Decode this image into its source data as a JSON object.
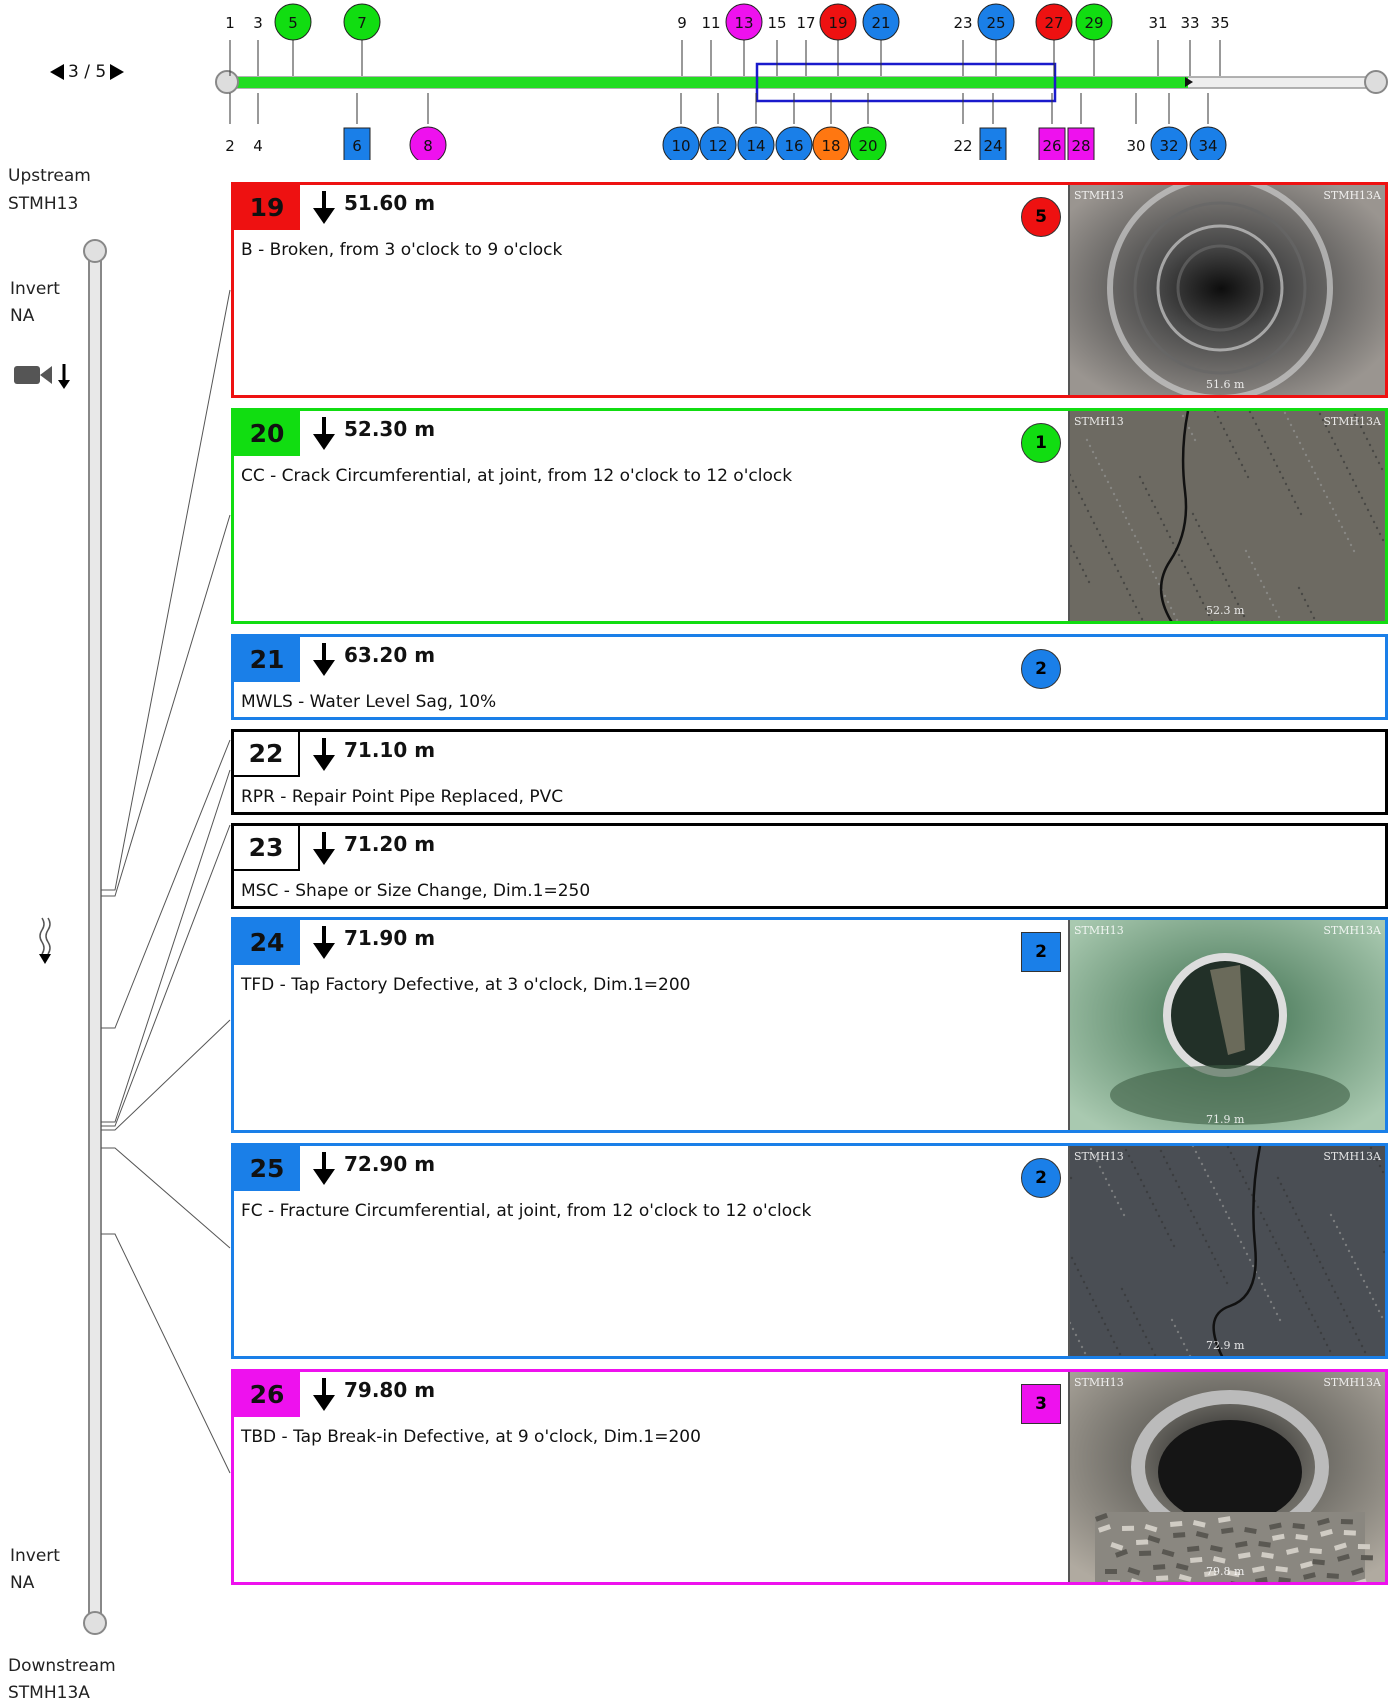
{
  "pager": {
    "text": "3 / 5"
  },
  "pipe": {
    "upstream_label": "Upstream",
    "upstream_id": "STMH13",
    "downstream_label": "Downstream",
    "downstream_id": "STMH13A",
    "invert_top_label": "Invert",
    "invert_top_value": "NA",
    "invert_bottom_label": "Invert",
    "invert_bottom_value": "NA"
  },
  "colors": {
    "red": "#ee1111",
    "green": "#11dd11",
    "blue": "#1a7fe8",
    "magenta": "#ee11ee",
    "orange": "#ff7711",
    "white": "#ffffff",
    "timeline": "#22dd22"
  },
  "timeline": {
    "top_markers": [
      {
        "label": "1",
        "color": "none"
      },
      {
        "label": "3",
        "color": "none"
      },
      {
        "label": "5",
        "color": "green",
        "shape": "circle"
      },
      {
        "label": "7",
        "color": "green",
        "shape": "circle"
      },
      {
        "label": "9",
        "color": "none"
      },
      {
        "label": "11",
        "color": "none"
      },
      {
        "label": "13",
        "color": "magenta",
        "shape": "circle"
      },
      {
        "label": "15",
        "color": "none"
      },
      {
        "label": "17",
        "color": "none"
      },
      {
        "label": "19",
        "color": "red",
        "shape": "circle"
      },
      {
        "label": "21",
        "color": "blue",
        "shape": "circle"
      },
      {
        "label": "23",
        "color": "none"
      },
      {
        "label": "25",
        "color": "blue",
        "shape": "circle"
      },
      {
        "label": "27",
        "color": "red",
        "shape": "circle"
      },
      {
        "label": "29",
        "color": "green",
        "shape": "circle"
      },
      {
        "label": "31",
        "color": "none"
      },
      {
        "label": "33",
        "color": "none"
      },
      {
        "label": "35",
        "color": "none"
      }
    ],
    "bottom_markers": [
      {
        "label": "2",
        "color": "none"
      },
      {
        "label": "4",
        "color": "none"
      },
      {
        "label": "6",
        "color": "blue",
        "shape": "square"
      },
      {
        "label": "8",
        "color": "magenta",
        "shape": "circle"
      },
      {
        "label": "10",
        "color": "blue",
        "shape": "circle"
      },
      {
        "label": "12",
        "color": "blue",
        "shape": "circle"
      },
      {
        "label": "14",
        "color": "blue",
        "shape": "circle"
      },
      {
        "label": "16",
        "color": "blue",
        "shape": "circle"
      },
      {
        "label": "18",
        "color": "orange",
        "shape": "circle"
      },
      {
        "label": "20",
        "color": "green",
        "shape": "circle"
      },
      {
        "label": "22",
        "color": "none"
      },
      {
        "label": "24",
        "color": "blue",
        "shape": "square"
      },
      {
        "label": "26",
        "color": "magenta",
        "shape": "square"
      },
      {
        "label": "28",
        "color": "magenta",
        "shape": "square"
      },
      {
        "label": "30",
        "color": "none"
      },
      {
        "label": "32",
        "color": "blue",
        "shape": "circle"
      },
      {
        "label": "34",
        "color": "blue",
        "shape": "circle"
      }
    ]
  },
  "observations": [
    {
      "number": "19",
      "distance": "51.60 m",
      "description": "B - Broken, from 3 o'clock to 9 o'clock",
      "grade": "5",
      "grade_shape": "circle",
      "color": "red",
      "photo": true,
      "photo_style": "pipe-dark",
      "photo_left": "STMH13",
      "photo_right": "STMH13A",
      "photo_distance": "51.6 m"
    },
    {
      "number": "20",
      "distance": "52.30 m",
      "description": "CC - Crack Circumferential, at joint, from 12 o'clock to 12 o'clock",
      "grade": "1",
      "grade_shape": "circle",
      "color": "green",
      "photo": true,
      "photo_style": "crack",
      "photo_left": "STMH13",
      "photo_right": "STMH13A",
      "photo_distance": "52.3 m"
    },
    {
      "number": "21",
      "distance": "63.20 m",
      "description": "MWLS - Water Level Sag, 10%",
      "grade": "2",
      "grade_shape": "circle",
      "color": "blue",
      "photo": false
    },
    {
      "number": "22",
      "distance": "71.10 m",
      "description": "RPR - Repair Point Pipe Replaced, PVC",
      "grade": "",
      "color": "white",
      "photo": false
    },
    {
      "number": "23",
      "distance": "71.20 m",
      "description": "MSC - Shape or Size Change, Dim.1=250",
      "grade": "",
      "color": "white",
      "photo": false
    },
    {
      "number": "24",
      "distance": "71.90 m",
      "description": "TFD - Tap Factory Defective, at 3 o'clock, Dim.1=200",
      "grade": "2",
      "grade_shape": "square",
      "color": "blue",
      "photo": true,
      "photo_style": "pipe-green",
      "photo_left": "STMH13",
      "photo_right": "STMH13A",
      "photo_distance": "71.9 m"
    },
    {
      "number": "25",
      "distance": "72.90 m",
      "description": "FC - Fracture Circumferential, at joint, from 12 o'clock to 12 o'clock",
      "grade": "2",
      "grade_shape": "circle",
      "color": "blue",
      "photo": true,
      "photo_style": "fracture",
      "photo_left": "STMH13",
      "photo_right": "STMH13A",
      "photo_distance": "72.9 m"
    },
    {
      "number": "26",
      "distance": "79.80 m",
      "description": "TBD - Tap Break-in Defective, at 9 o'clock, Dim.1=200",
      "grade": "3",
      "grade_shape": "square",
      "color": "magenta",
      "photo": true,
      "photo_style": "pipe-debris",
      "photo_left": "STMH13",
      "photo_right": "STMH13A",
      "photo_distance": "79.8 m"
    }
  ]
}
